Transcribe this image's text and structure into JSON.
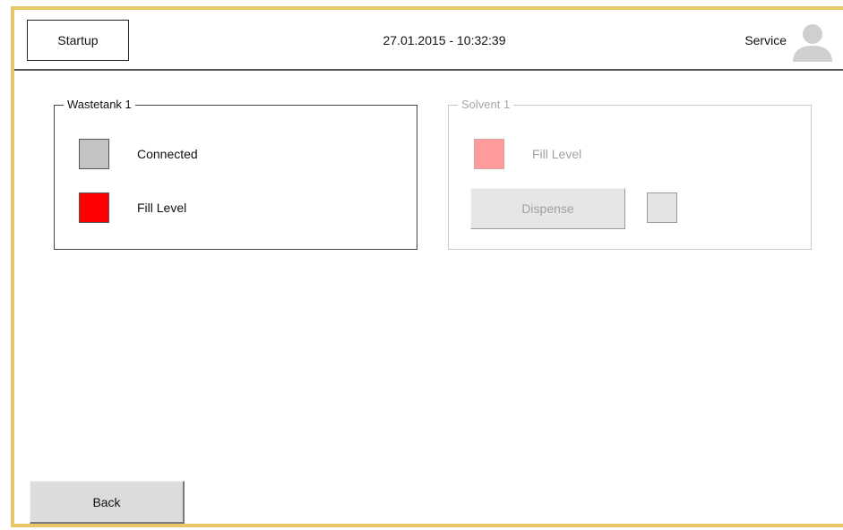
{
  "header": {
    "startup_label": "Startup",
    "datetime": "27.01.2015  -  10:32:39",
    "user_label": "Service",
    "user_icon": "user-icon"
  },
  "wastetank": {
    "title": "Wastetank 1",
    "connected_label": "Connected",
    "fill_level_label": "Fill Level",
    "connected_color": "#c3c3c3",
    "fill_level_color": "#ff0000"
  },
  "solvent": {
    "title": "Solvent 1",
    "fill_level_label": "Fill Level",
    "dispense_label": "Dispense",
    "fill_level_color": "#ff9b9b",
    "dispense_status_color": "#e4e4e4",
    "enabled": false
  },
  "footer": {
    "back_label": "Back"
  },
  "colors": {
    "frame_accent": "#e8c76a"
  }
}
